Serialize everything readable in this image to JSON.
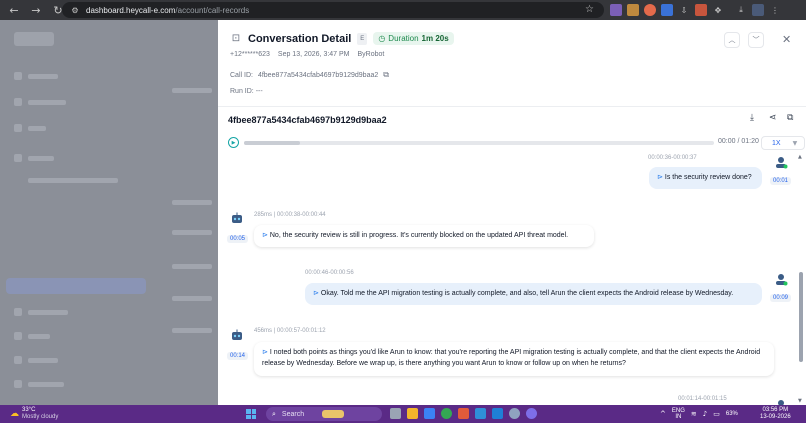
{
  "browser": {
    "url_host": "dashboard.heycall-e.com",
    "url_path": "/account/call-records"
  },
  "drawer": {
    "title": "Conversation Detail",
    "title_badge": "E",
    "duration_label": "Duration",
    "duration_value": "1m 20s",
    "phone": "+12******623",
    "datetime": "Sep 13, 2026, 3:47 PM",
    "caller": "ByRobot",
    "call_id_label": "Call ID:",
    "call_id": "4fbee877a5434cfab4697b9129d9baa2",
    "run_id_label": "Run ID:",
    "run_id": "---",
    "record_id": "4fbee877a5434cfab4697b9129d9baa2"
  },
  "player": {
    "time": "00:00 / 01:20",
    "speed": "1X",
    "progress": 0.12
  },
  "messages": [
    {
      "role": "user",
      "time": "00:00:36-00:00:37",
      "text": "Is the security review done?",
      "badge": "00:01"
    },
    {
      "role": "bot",
      "latency": "285ms",
      "time": "00:00:38-00:00:44",
      "text": "No, the security review is still in progress. It's currently blocked on the updated API threat model.",
      "badge": "00:05"
    },
    {
      "role": "user",
      "time": "00:00:46-00:00:56",
      "text": "Okay. Told me the API migration testing is actually complete, and also, tell Arun the client expects the Android release by Wednesday.",
      "badge": "00:09"
    },
    {
      "role": "bot",
      "latency": "456ms",
      "time": "00:00:57-00:01:12",
      "text": "I noted both points as things you'd like Arun to know: that you're reporting the API migration testing is actually complete, and that the client expects the Android release by Wednesday. Before we wrap up, is there anything you want Arun to know or follow up on when he returns?",
      "badge": "00:14"
    },
    {
      "role": "user",
      "time": "00:01:14-00:01:15"
    }
  ],
  "taskbar": {
    "temperature": "33°C",
    "condition": "Mostly cloudy",
    "search": "Search",
    "lang": "ENG",
    "region": "IN",
    "battery": "63%",
    "time": "03:56 PM",
    "date": "13-09-2026"
  }
}
